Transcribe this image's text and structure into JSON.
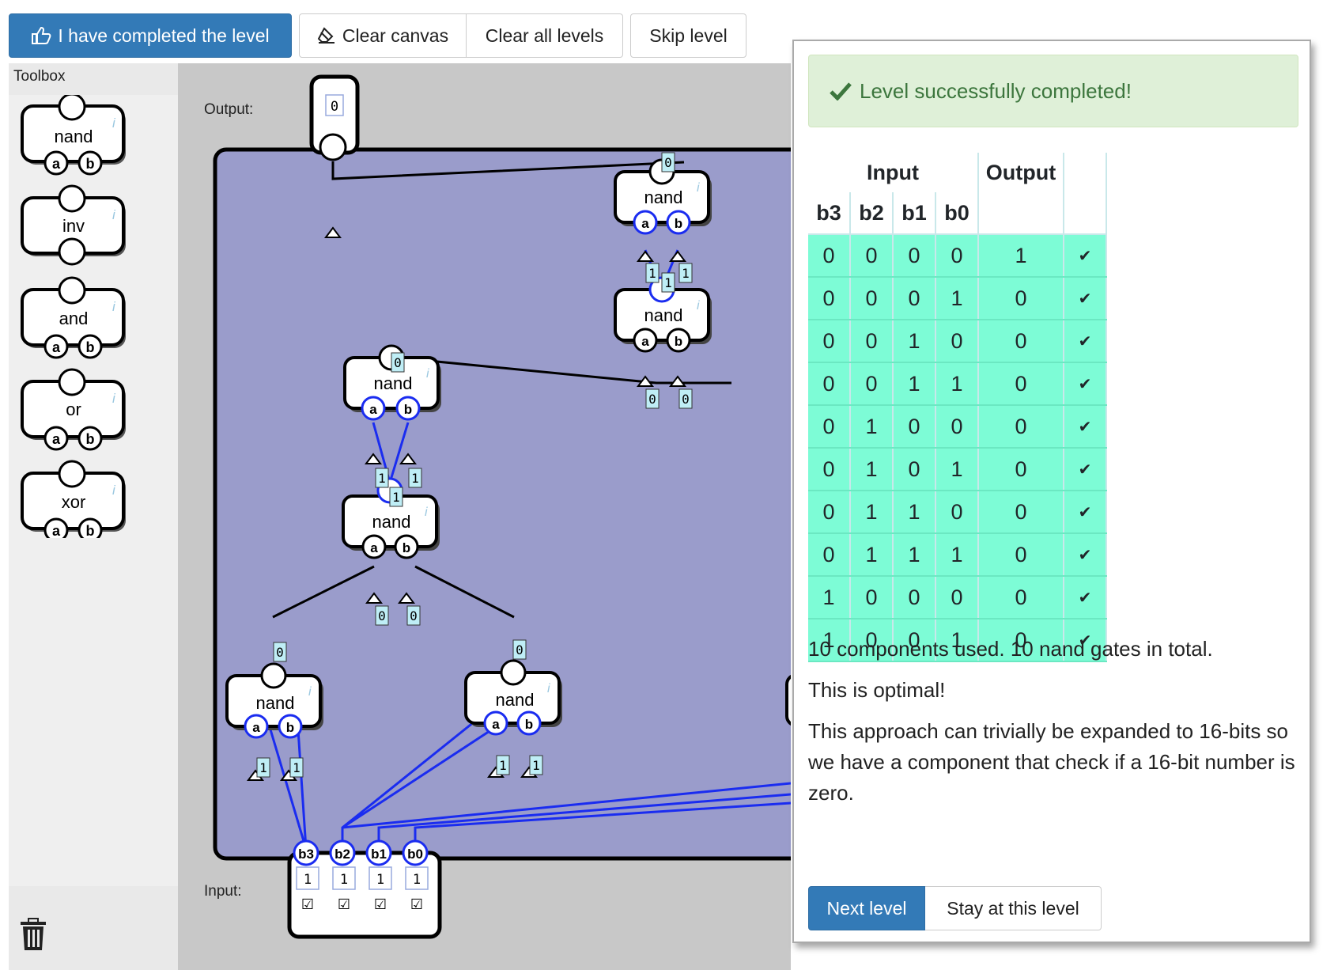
{
  "toolbar": {
    "complete_label": "I have completed the level",
    "clear_canvas_label": "Clear canvas",
    "clear_all_label": "Clear all levels",
    "skip_label": "Skip level"
  },
  "toolbox": {
    "title": "Toolbox",
    "items": [
      {
        "name": "nand",
        "inputs": [
          "a",
          "b"
        ]
      },
      {
        "name": "inv",
        "inputs": []
      },
      {
        "name": "and",
        "inputs": [
          "a",
          "b"
        ]
      },
      {
        "name": "or",
        "inputs": [
          "a",
          "b"
        ]
      },
      {
        "name": "xor",
        "inputs": [
          "a",
          "b"
        ]
      }
    ]
  },
  "canvas": {
    "output_label": "Output:",
    "input_label": "Input:",
    "output_value": "0",
    "input_pins": [
      "b3",
      "b2",
      "b1",
      "b0"
    ],
    "input_values": [
      "1",
      "1",
      "1",
      "1"
    ],
    "input_checks": [
      "☑",
      "☑",
      "☑",
      "☑"
    ],
    "gate_label": "nand",
    "pin_a": "a",
    "pin_b": "b",
    "info_glyph": "i",
    "wire_values": {
      "w_out": "0",
      "g1_a": "1",
      "g1_b": "1",
      "g1_mid": "1",
      "g2_a": "0",
      "g2_b": "0",
      "g3_out": "0",
      "g3_a": "1",
      "g3_b": "1",
      "g3_mid": "1",
      "g4_a": "0",
      "g4_b": "0",
      "g5_out": "0",
      "g6_out": "0",
      "g5_a": "1",
      "g5_b": "1",
      "g6_a": "1",
      "g6_b": "1"
    }
  },
  "dialog": {
    "success": "Level successfully completed!",
    "table": {
      "group_input": "Input",
      "group_output": "Output",
      "columns": [
        "b3",
        "b2",
        "b1",
        "b0"
      ],
      "rows": [
        [
          "0",
          "0",
          "0",
          "0",
          "1",
          "✔"
        ],
        [
          "0",
          "0",
          "0",
          "1",
          "0",
          "✔"
        ],
        [
          "0",
          "0",
          "1",
          "0",
          "0",
          "✔"
        ],
        [
          "0",
          "0",
          "1",
          "1",
          "0",
          "✔"
        ],
        [
          "0",
          "1",
          "0",
          "0",
          "0",
          "✔"
        ],
        [
          "0",
          "1",
          "0",
          "1",
          "0",
          "✔"
        ],
        [
          "0",
          "1",
          "1",
          "0",
          "0",
          "✔"
        ],
        [
          "0",
          "1",
          "1",
          "1",
          "0",
          "✔"
        ],
        [
          "1",
          "0",
          "0",
          "0",
          "0",
          "✔"
        ],
        [
          "1",
          "0",
          "0",
          "1",
          "0",
          "✔"
        ]
      ]
    },
    "summary": "10 components used. 10 nand gates in total.",
    "optimal": "This is optimal!",
    "note": "This approach can trivially be expanded to 16-bits so we have a component that check if a 16-bit number is zero.",
    "next_label": "Next level",
    "stay_label": "Stay at this level"
  },
  "colors": {
    "primary": "#337ab7",
    "canvas_bg": "#c8c8c8",
    "circuit_bg": "#9a9ccb",
    "wire_on": "#1a2cf0",
    "success_bg": "#dff0d8",
    "table_row": "#7dfcd6"
  }
}
